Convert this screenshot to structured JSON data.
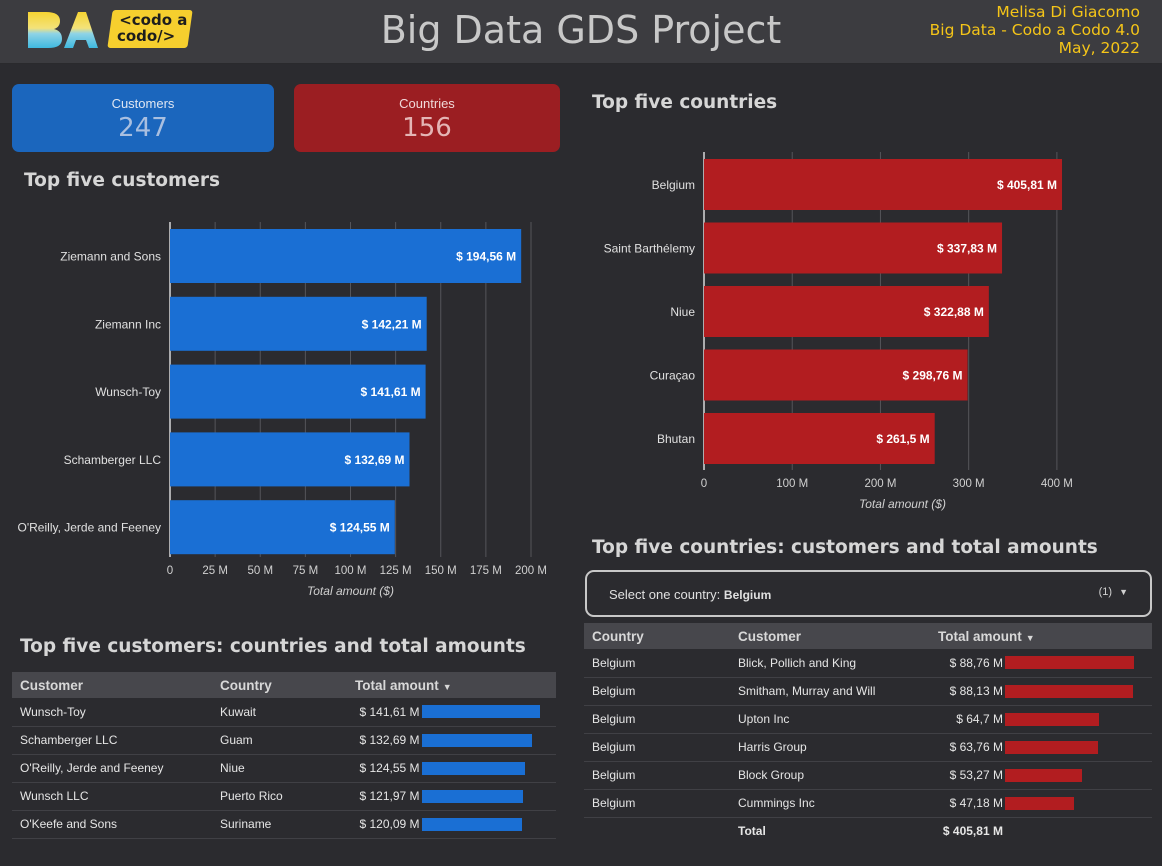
{
  "header": {
    "title": "Big Data GDS Project",
    "author": "Melisa Di Giacomo",
    "course": "Big Data - Codo a Codo 4.0",
    "date": "May, 2022",
    "logo_codo_line1": "<codo a",
    "logo_codo_line2": "codo/>"
  },
  "kpis": {
    "customers_label": "Customers",
    "customers_value": "247",
    "countries_label": "Countries",
    "countries_value": "156"
  },
  "sections": {
    "top_customers": "Top five customers",
    "top_countries": "Top five countries",
    "customers_table": "Top five customers: countries and total amounts",
    "countries_table": "Top five countries: customers and total amounts"
  },
  "colors": {
    "blue": "#1a6fd4",
    "red": "#b21d20",
    "accent": "#f5c518"
  },
  "chart_data": [
    {
      "type": "bar",
      "orientation": "horizontal",
      "categories": [
        "Ziemann and Sons",
        "Ziemann Inc",
        "Wunsch-Toy",
        "Schamberger LLC",
        "O'Reilly, Jerde and Feeney"
      ],
      "values": [
        194.56,
        142.21,
        141.61,
        132.69,
        124.55
      ],
      "value_labels": [
        "$ 194,56 M",
        "$ 142,21 M",
        "$ 141,61 M",
        "$ 132,69 M",
        "$ 124,55 M"
      ],
      "xlabel": "Total amount ($)",
      "xlim": [
        0,
        200
      ],
      "xticks": [
        0,
        25,
        50,
        75,
        100,
        125,
        150,
        175,
        200
      ],
      "xtick_labels": [
        "0",
        "25 M",
        "50 M",
        "75 M",
        "100 M",
        "125 M",
        "150 M",
        "175 M",
        "200 M"
      ],
      "color": "#1a6fd4",
      "grid": true
    },
    {
      "type": "bar",
      "orientation": "horizontal",
      "categories": [
        "Belgium",
        "Saint Barthélemy",
        "Niue",
        "Curaçao",
        "Bhutan"
      ],
      "values": [
        405.81,
        337.83,
        322.88,
        298.76,
        261.5
      ],
      "value_labels": [
        "$ 405,81 M",
        "$ 337,83 M",
        "$ 322,88 M",
        "$ 298,76 M",
        "$ 261,5 M"
      ],
      "xlabel": "Total amount ($)",
      "xlim": [
        0,
        450
      ],
      "xticks": [
        0,
        100,
        200,
        300,
        400
      ],
      "xtick_labels": [
        "0",
        "100 M",
        "200 M",
        "300 M",
        "400 M"
      ],
      "color": "#b21d20",
      "grid": true
    }
  ],
  "customers_table": {
    "columns": [
      "Customer",
      "Country",
      "Total amount"
    ],
    "sort_icon": "caret-down-icon",
    "rows": [
      {
        "customer": "Wunsch-Toy",
        "country": "Kuwait",
        "amount": "$ 141,61 M",
        "value": 141.61
      },
      {
        "customer": "Schamberger LLC",
        "country": "Guam",
        "amount": "$ 132,69 M",
        "value": 132.69
      },
      {
        "customer": "O'Reilly, Jerde and Feeney",
        "country": "Niue",
        "amount": "$ 124,55 M",
        "value": 124.55
      },
      {
        "customer": "Wunsch LLC",
        "country": "Puerto Rico",
        "amount": "$ 121,97 M",
        "value": 121.97
      },
      {
        "customer": "O'Keefe and Sons",
        "country": "Suriname",
        "amount": "$ 120,09 M",
        "value": 120.09
      }
    ]
  },
  "country_selector": {
    "label": "Select one country:",
    "value": "Belgium",
    "count": "(1)",
    "icon": "caret-down-icon"
  },
  "countries_table": {
    "columns": [
      "Country",
      "Customer",
      "Total amount"
    ],
    "sort_icon": "caret-down-icon",
    "rows": [
      {
        "country": "Belgium",
        "customer": "Blick, Pollich and King",
        "amount": "$ 88,76 M",
        "value": 88.76
      },
      {
        "country": "Belgium",
        "customer": "Smitham, Murray and Will",
        "amount": "$ 88,13 M",
        "value": 88.13
      },
      {
        "country": "Belgium",
        "customer": "Upton Inc",
        "amount": "$ 64,7 M",
        "value": 64.7
      },
      {
        "country": "Belgium",
        "customer": "Harris Group",
        "amount": "$ 63,76 M",
        "value": 63.76
      },
      {
        "country": "Belgium",
        "customer": "Block Group",
        "amount": "$ 53,27 M",
        "value": 53.27
      },
      {
        "country": "Belgium",
        "customer": "Cummings Inc",
        "amount": "$ 47,18 M",
        "value": 47.18
      }
    ],
    "total_label": "Total",
    "total_value": "$ 405,81 M"
  }
}
